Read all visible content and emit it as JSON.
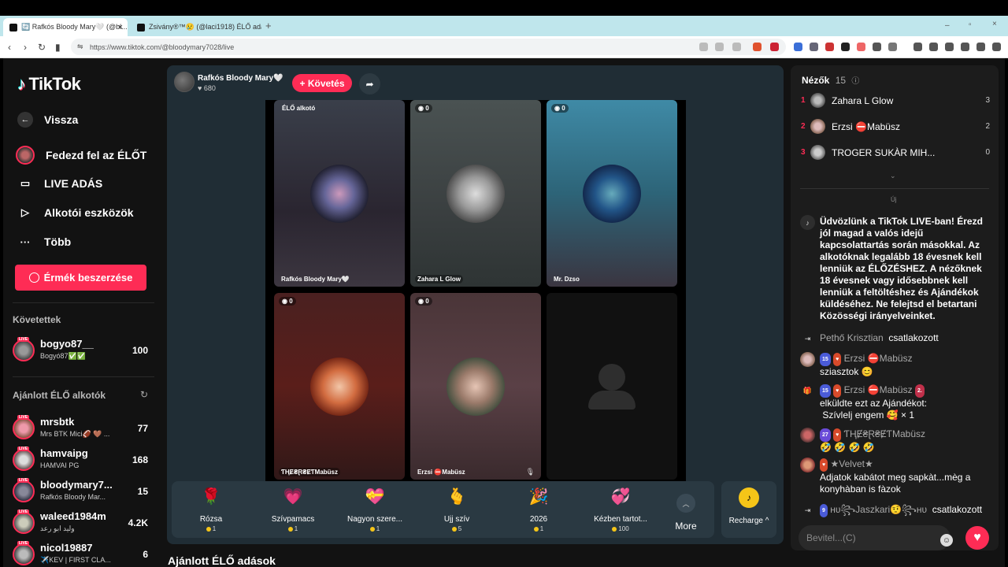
{
  "browser": {
    "tabs": [
      {
        "title": "🔄 Rafkós Bloody Mary🤍 (@bl...",
        "active": true
      },
      {
        "title": "Zsivány®™😢 (@laci1918) ÉLŐ adás",
        "active": false
      }
    ],
    "new_tab": "+",
    "url": "https://www.tiktok.com/@bloodymary7028/live"
  },
  "sidebar": {
    "logo": "TikTok",
    "nav": [
      {
        "label": "Vissza",
        "icon": "back-arrow-icon"
      },
      {
        "label": "Fedezd fel az ÉLŐT",
        "icon": "avatar-icon"
      },
      {
        "label": "LIVE ADÁS",
        "icon": "video-camera-icon"
      },
      {
        "label": "Alkotói eszközök",
        "icon": "creator-tools-icon"
      },
      {
        "label": "Több",
        "icon": "more-dots-icon"
      }
    ],
    "coin_button": "Érmék beszerzése",
    "following_title": "Követettek",
    "following": [
      {
        "name": "bogyo87__",
        "sub": "Bogyó87✅✅",
        "count": "100"
      }
    ],
    "suggested_title": "Ajánlott ÉLŐ alkotók",
    "suggested": [
      {
        "name": "mrsbtk",
        "sub": "Mrs BTK Mici🏈 🤎 ...",
        "count": "77"
      },
      {
        "name": "hamvaipg",
        "sub": "HAMVAI PG",
        "count": "168"
      },
      {
        "name": "bloodymary7...",
        "sub": "Rafkós Bloody Mar...",
        "count": "15"
      },
      {
        "name": "waleed1984m",
        "sub": "وليد ابو رعد",
        "count": "4.2K"
      },
      {
        "name": "nicol19887",
        "sub": "✈️KEV | FIRST CLA...",
        "count": "6"
      }
    ],
    "live_badge": "LIVE"
  },
  "stream": {
    "host_name": "Rafkós Bloody Mary🤍",
    "host_likes": "680",
    "follow_label": "+ Követés",
    "tiles": [
      {
        "badge": "ÉLŐ alkotó",
        "label": "Rafkós Bloody Mary🤍"
      },
      {
        "badge": "0",
        "label": "Zahara L Glow"
      },
      {
        "badge": "0",
        "label": "Mr. Dzso"
      },
      {
        "badge": "0",
        "label": "ƬⱧɆ₴Ɽ₴ɆƬMabüsz"
      },
      {
        "badge": "0",
        "label": "Erzsi ⛔Mabüsz"
      }
    ],
    "gifts": [
      {
        "name": "Rózsa",
        "price": "1",
        "icon": "🌹"
      },
      {
        "name": "Szívpamacs",
        "price": "1",
        "icon": "💗"
      },
      {
        "name": "Nagyon szere...",
        "price": "1",
        "icon": "💝"
      },
      {
        "name": "Ujj szív",
        "price": "5",
        "icon": "🫰"
      },
      {
        "name": "2026",
        "price": "1",
        "icon": "🎉"
      },
      {
        "name": "Kézben tartot...",
        "price": "100",
        "icon": "💞"
      }
    ],
    "more_label": "More",
    "recharge_label": "Recharge ^",
    "bottom_heading": "Ajánlott ÉLŐ adások"
  },
  "viewers": {
    "title": "Nézők",
    "count": "15",
    "list": [
      {
        "rank": "1",
        "name": "Zahara L Glow",
        "score": "3"
      },
      {
        "rank": "2",
        "name": "Erzsi ⛔Mabüsz",
        "score": "2"
      },
      {
        "rank": "3",
        "name": "TROGER SUKÀR MIH...",
        "score": "0"
      }
    ],
    "new_label": "Új"
  },
  "chat": {
    "welcome": "Üdvözlünk a TikTok LIVE-ban! Érezd jól magad a valós idejű kapcsolattartás során másokkal. Az alkotóknak legalább 18 évesnek kell lenniük az ÉLŐZÉSHEZ. A nézőknek 18 évesnek vagy idősebbnek kell lenniük a feltöltéshez és Ajándékok küldéséhez. Ne felejtsd el betartani Közösségi irányelveinket.",
    "joined1_name": "Pethő Krisztian",
    "joined_text": "csatlakozott",
    "m1_level": "15",
    "m1_name": "Erzsi ⛔Mabüsz",
    "m1_text": "sziasztok 😊",
    "m2_level": "15",
    "m2_name": "Erzsi ⛔Mabüsz",
    "m2_rank": "2.",
    "m2_text": "elküldte ezt az Ajándékot:",
    "m2_gift": "Szívlelj engem 🥰 × 1",
    "m3_level": "27",
    "m3_name": "ƬⱧɆ₴Ɽ₴ɆƬMabüsz",
    "m3_text": "🤣 🤣 🤣 🤣",
    "m4_name": "★Velvet★",
    "m4_text": "Adjatok kabátot meg sapkàt...mèg a konyhàban is fàzok",
    "joined2_level": "9",
    "joined2_name": "ʜᴜ꧂Jaszkari🤨꧂ʜᴜ",
    "input_placeholder": "Bevitel...(C)"
  },
  "colors": {
    "accent": "#fe2c55",
    "panel": "#1c1c1c",
    "stream_bg": "#202d35"
  }
}
